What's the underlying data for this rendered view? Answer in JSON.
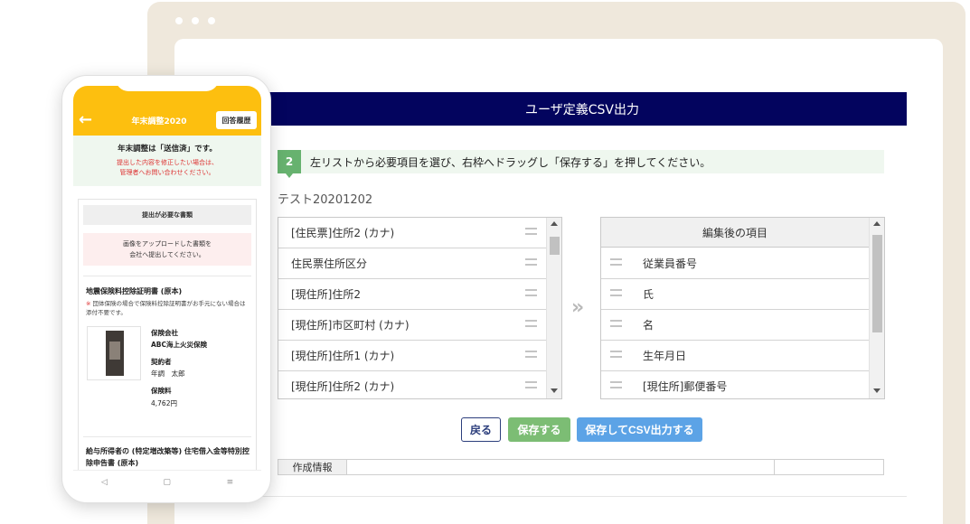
{
  "screen": {
    "title": "ユーザ定義CSV出力",
    "step": {
      "number": "2",
      "text": "左リストから必要項目を選び、右枠へドラッグし「保存する」を押してください。"
    },
    "list_name": "テスト20201202",
    "left_items": [
      "[住民票]住所2 (カナ)",
      "住民票住所区分",
      "[現住所]住所2",
      "[現住所]市区町村 (カナ)",
      "[現住所]住所1 (カナ)",
      "[現住所]住所2 (カナ)"
    ],
    "right_header": "編集後の項目",
    "right_items": [
      "従業員番号",
      "氏",
      "名",
      "生年月日",
      "[現住所]郵便番号"
    ],
    "move_icon": "»",
    "buttons": {
      "back": "戻る",
      "save": "保存する",
      "save_csv": "保存してCSV出力する"
    },
    "info_label": "作成情報"
  },
  "phone": {
    "header_title": "年末調整2020",
    "history_button": "回答履歴",
    "status_title": "年末調整は「送信済」です。",
    "status_line1": "提出した内容を修正したい場合は、",
    "status_line2": "管理者へお問い合わせください。",
    "section_title": "提出が必要な書類",
    "upload_line1": "画像をアップロードした書類を",
    "upload_line2": "会社へ提出してください。",
    "doc1_title": "地震保険料控除証明書 (原本)",
    "doc1_mark": "※",
    "doc1_note": "団体保険の場合で保険料控除証明書がお手元にない場合は添付不要です。",
    "insurer_label": "保険会社",
    "insurer_value": "ABC海上火災保険",
    "holder_label": "契約者",
    "holder_value": "年調　太郎",
    "premium_label": "保険料",
    "premium_value": "4,762円",
    "doc2_title": "給与所得者の (特定増改築等) 住宅借入金等特別控除申告書 (原本)",
    "nav": [
      "◁",
      "▢",
      "≡"
    ]
  },
  "colors": {
    "title_bar": "#03045e",
    "phone_header": "#fdbf0f",
    "save": "#7cbd74",
    "save_csv": "#5ca3e6",
    "step_badge": "#67b26f"
  }
}
